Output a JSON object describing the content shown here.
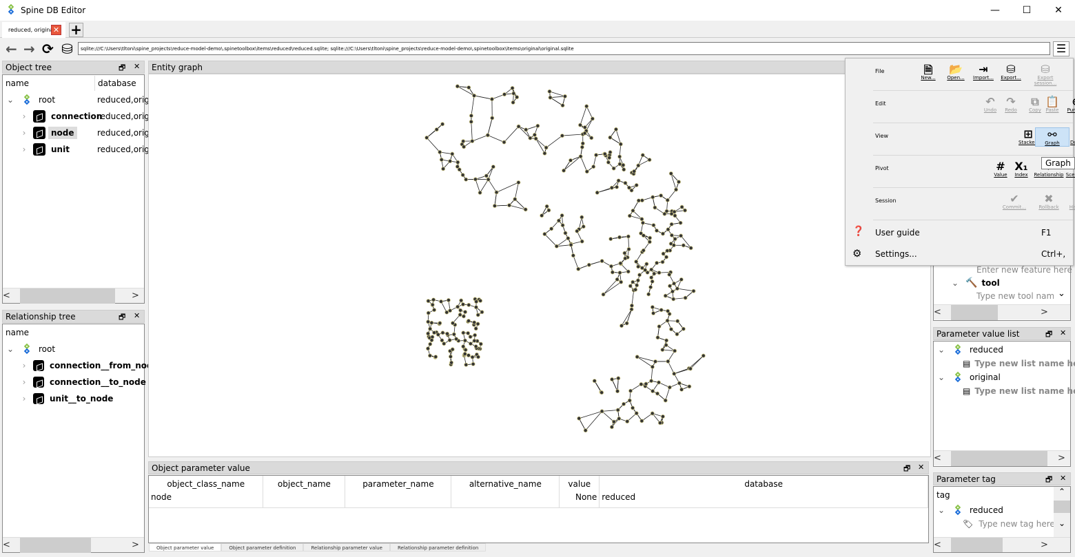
{
  "window": {
    "title": "Spine DB Editor",
    "minimize": "—",
    "maximize": "☐",
    "close": "✕"
  },
  "tabs": [
    {
      "label": "reduced, original"
    }
  ],
  "add_tab": "+",
  "toolbar": {
    "url": "sqlite:///C:\\Users\\tltoni\\spine_projects\\reduce-model-demo\\.spinetoolbox\\items\\reduced\\reduced.sqlite; sqlite:///C:\\Users\\tltoni\\spine_projects\\reduce-model-demo\\.spinetoolbox\\items\\original\\original.sqlite",
    "back": "←",
    "forward": "→",
    "refresh": "⟳",
    "db": "⛁",
    "menu": "☰"
  },
  "object_tree": {
    "title": "Object tree",
    "col_name": "name",
    "col_db": "database",
    "root": "root",
    "items": [
      {
        "label": "connection",
        "db": "reduced,orig"
      },
      {
        "label": "node",
        "db": "reduced,orig",
        "selected": true
      },
      {
        "label": "unit",
        "db": "reduced,orig"
      }
    ],
    "root_db": "reduced,orig"
  },
  "relationship_tree": {
    "title": "Relationship tree",
    "col_name": "name",
    "root": "root",
    "items": [
      {
        "label": "connection__from_node"
      },
      {
        "label": "connection__to_node"
      },
      {
        "label": "unit__to_node"
      }
    ]
  },
  "entity_graph": {
    "title": "Entity graph"
  },
  "object_parameter_value": {
    "title": "Object parameter value",
    "columns": [
      "object_class_name",
      "object_name",
      "parameter_name",
      "alternative_name",
      "value",
      "database"
    ],
    "rows": [
      [
        "node",
        "",
        "",
        "",
        "None",
        "reduced"
      ]
    ]
  },
  "bottom_tabs": [
    "Object parameter value",
    "Object parameter definition",
    "Relationship parameter value",
    "Relationship parameter definition"
  ],
  "tool_dock": {
    "feature_placeholder": "Enter new feature here",
    "tool": "tool",
    "tool_placeholder": "Type new tool name here"
  },
  "parameter_value_list": {
    "title": "Parameter value list",
    "dbs": [
      "reduced",
      "original"
    ],
    "placeholder": "Type new list name here"
  },
  "parameter_tag": {
    "title": "Parameter tag",
    "col": "tag",
    "db": "reduced",
    "placeholder": "Type new tag here..."
  },
  "menu": {
    "sections": [
      {
        "label": "File",
        "items": [
          {
            "label": "New...",
            "icon": "file-icon"
          },
          {
            "label": "Open...",
            "icon": "folder-open-icon"
          },
          {
            "label": "Import...",
            "icon": "import-icon"
          },
          {
            "label": "Export...",
            "icon": "export-icon"
          },
          {
            "label": "Export session...",
            "icon": "export-session-icon",
            "disabled": true
          }
        ]
      },
      {
        "label": "Edit",
        "items": [
          {
            "label": "Undo",
            "icon": "undo-icon",
            "disabled": true
          },
          {
            "label": "Redo",
            "icon": "redo-icon",
            "disabled": true
          },
          {
            "label": "Copy",
            "icon": "copy-icon",
            "disabled": true
          },
          {
            "label": "Paste",
            "icon": "paste-icon",
            "disabled": true
          },
          {
            "label": "Purge...",
            "icon": "purge-icon"
          }
        ]
      },
      {
        "label": "View",
        "items": [
          {
            "label": "Stacked",
            "icon": "table-icon"
          },
          {
            "label": "Graph",
            "icon": "graph-icon",
            "active": true
          },
          {
            "label": "Docks...",
            "icon": "window-icon"
          }
        ]
      },
      {
        "label": "Pivot",
        "items": [
          {
            "label": "Value",
            "icon": "hash-icon"
          },
          {
            "label": "Index",
            "icon": "index-icon"
          },
          {
            "label": "Relationship",
            "icon": "cubes-icon"
          },
          {
            "label": "Scenario",
            "icon": "scenario-icon"
          }
        ]
      },
      {
        "label": "Session",
        "items": [
          {
            "label": "Commit...",
            "icon": "check-icon",
            "disabled": true
          },
          {
            "label": "Rollback",
            "icon": "x-icon",
            "disabled": true
          },
          {
            "label": "History...",
            "icon": "history-icon",
            "disabled": true
          }
        ]
      }
    ],
    "user_guide": "User guide",
    "user_guide_shortcut": "F1",
    "settings": "Settings...",
    "settings_shortcut": "Ctrl+,",
    "tooltip": "Graph"
  }
}
